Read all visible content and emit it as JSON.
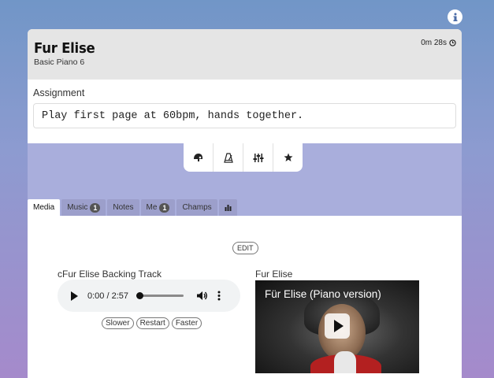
{
  "lesson": {
    "title": "Fur Elise",
    "subtitle": "Basic Piano 6",
    "timer": "0m 28s"
  },
  "assignment": {
    "label": "Assignment",
    "text": "Play first page at 60bpm, hands together."
  },
  "toolbar": {
    "tools": [
      "helmet-icon",
      "metronome-icon",
      "sliders-icon",
      "star-icon"
    ]
  },
  "tabs": [
    {
      "label": "Media",
      "active": true
    },
    {
      "label": "Music",
      "badge": "1"
    },
    {
      "label": "Notes"
    },
    {
      "label": "Me",
      "badge": "1"
    },
    {
      "label": "Champs"
    },
    {
      "label": "",
      "icon": "bar-chart-icon"
    }
  ],
  "media": {
    "edit_label": "EDIT",
    "audio": {
      "title": "cFur Elise Backing Track",
      "current_time": "0:00",
      "duration": "2:57",
      "time_display": "0:00 / 2:57",
      "progress": 0
    },
    "controls": [
      "Slower",
      "Restart",
      "Faster"
    ],
    "video": {
      "title": "Fur Elise",
      "caption": "Für Elise (Piano version)"
    }
  },
  "colors": {
    "accent_purple": "#a9aedc",
    "tab_inactive": "#9c9fcb",
    "header_gray": "#e5e5e5"
  }
}
